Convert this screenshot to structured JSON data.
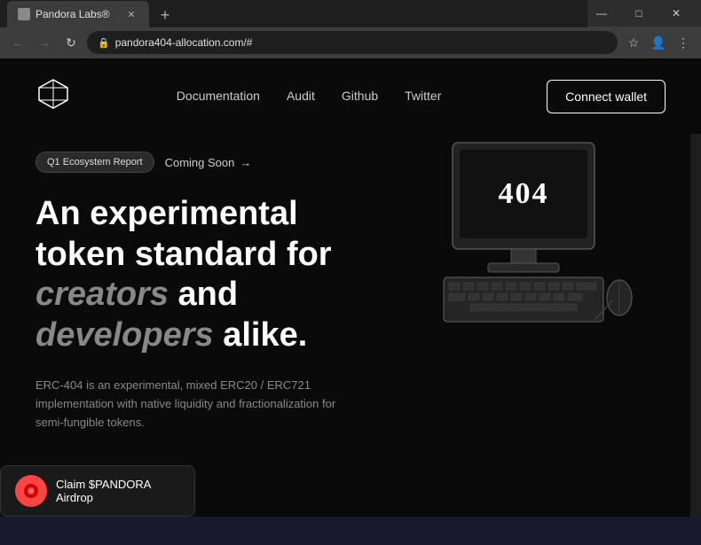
{
  "browser": {
    "tab_title": "Pandora Labs®",
    "tab_favicon": "pandora-favicon",
    "address": "pandora404-allocation.com/#",
    "new_tab_label": "+",
    "window_controls": {
      "minimize": "—",
      "maximize": "□",
      "close": "✕"
    }
  },
  "nav": {
    "logo_alt": "Pandora Labs Logo",
    "links": [
      {
        "label": "Documentation",
        "id": "documentation"
      },
      {
        "label": "Audit",
        "id": "audit"
      },
      {
        "label": "Github",
        "id": "github"
      },
      {
        "label": "Twitter",
        "id": "twitter"
      }
    ],
    "cta_label": "Connect wallet"
  },
  "hero": {
    "badge_label": "Q1 Ecosystem Report",
    "coming_soon_label": "Coming Soon",
    "coming_soon_arrow": "→",
    "title_line1": "An experimental",
    "title_line2": "token standard for",
    "title_highlight1": "creators",
    "title_and1": " and",
    "title_highlight2": "developers",
    "title_and2": " alike.",
    "description": "ERC-404 is an experimental, mixed ERC20 / ERC721 implementation with native liquidity and fractionalization for semi-fungible tokens.",
    "computer_404": "404"
  },
  "airdrop": {
    "label": "Claim $PANDORA Airdrop",
    "icon": "🔴"
  },
  "colors": {
    "background": "#0a0a0a",
    "text_primary": "#ffffff",
    "text_muted": "#888888",
    "accent": "#ffffff",
    "badge_bg": "#2a2a2a"
  }
}
